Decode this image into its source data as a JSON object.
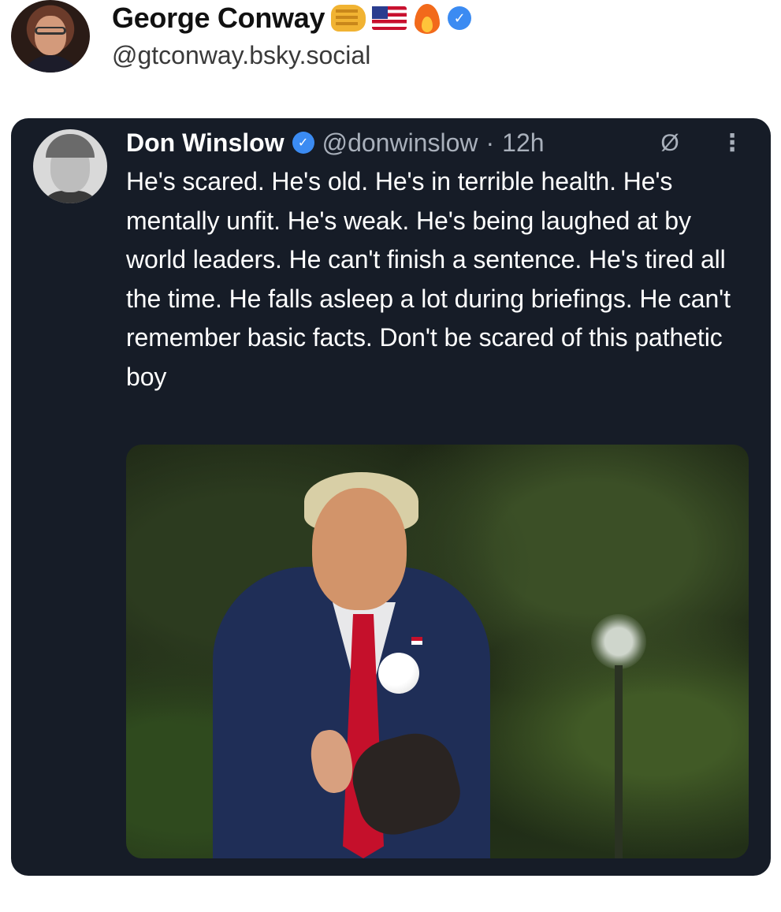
{
  "author": {
    "name": "George Conway",
    "handle": "@gtconway.bsky.social",
    "badges": [
      "flexed-fist-emoji",
      "us-flag-emoji",
      "fire-emoji",
      "verified-badge-icon"
    ],
    "verified_glyph": "✓"
  },
  "quote": {
    "name": "Don Winslow",
    "handle": "@donwinslow",
    "separator": "·",
    "time": "12h",
    "verified_glyph": "✓",
    "grok_icon": "Ø",
    "more_icon": "⋮",
    "text": "He's scared. He's old. He's in terrible health. He's mentally unfit. He's weak. He's being laughed at by world leaders. He can't finish a sentence. He's tired all the time. He falls asleep a lot during briefings. He can't remember basic facts. Don't be scared of this pathetic boy"
  },
  "colors": {
    "card_bg": "#161c27",
    "verified_blue": "#3b8bf2",
    "muted": "#a9b0bb"
  }
}
